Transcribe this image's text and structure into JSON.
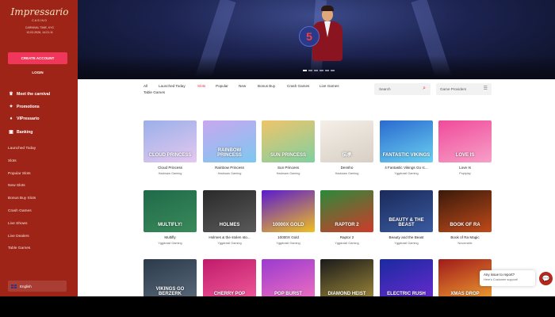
{
  "brand": {
    "name": "Impressario",
    "sub": "CASINO"
  },
  "meta": {
    "line1": "CARNIVAL TIME, KYC",
    "line2": "13.03.2026, 14:21:11"
  },
  "auth": {
    "create_account": "CREATE ACCOUNT",
    "login": "LOGIN"
  },
  "menu": [
    {
      "label": "Meet the carnival",
      "icon": "mask-icon",
      "glyph": "♛"
    },
    {
      "label": "Promotions",
      "icon": "gift-icon",
      "glyph": "✦"
    },
    {
      "label": "VIPressario",
      "icon": "vip-icon",
      "glyph": "♦"
    },
    {
      "label": "Banking",
      "icon": "wallet-icon",
      "glyph": "▣"
    }
  ],
  "categories": [
    "Launched Today",
    "Slots",
    "Popular Slots",
    "New Slots",
    "Bonus Buy Slots",
    "Crash Games",
    "Live Shows",
    "Live Dealers",
    "Table Games"
  ],
  "language": "English",
  "filters": {
    "tabs": [
      "All",
      "Launched Today",
      "Slots",
      "Popular",
      "New",
      "Bonus Buy",
      "Crash Games",
      "Live Games",
      "Table Games"
    ],
    "active": "Slots",
    "search_placeholder": "Search",
    "providers_label": "Game Providers"
  },
  "hero": {
    "badge": "5"
  },
  "games": [
    {
      "name": "Cloud Princess",
      "provider": "Hacksaw Gaming",
      "thumb_text": "CLOUD PRINCESS",
      "bg": "#9ab0e8",
      "bg2": "#e5c8f0"
    },
    {
      "name": "Rainbow Princess",
      "provider": "Hacksaw Gaming",
      "thumb_text": "RAINBOW PRINCESS",
      "bg": "#c9a7ef",
      "bg2": "#7cc8f0"
    },
    {
      "name": "Sun Princess",
      "provider": "Hacksaw Gaming",
      "thumb_text": "SUN PRINCESS",
      "bg": "#f0c46a",
      "bg2": "#7fd0a0"
    },
    {
      "name": "Densho",
      "provider": "Hacksaw Gaming",
      "thumb_text": "伝承",
      "bg": "#f4efe8",
      "bg2": "#d8cfc4"
    },
    {
      "name": "4 Fantastic Vikings Go Ic...",
      "provider": "Yggdrasil Gaming",
      "thumb_text": "FANTASTIC VIKINGS",
      "bg": "#2a6ad0",
      "bg2": "#6ad0f0"
    },
    {
      "name": "Love Is",
      "provider": "Popiplay",
      "thumb_text": "LOVE IS",
      "bg": "#f04a9a",
      "bg2": "#f7a0c8"
    },
    {
      "name": "Multifly",
      "provider": "Yggdrasil Gaming",
      "thumb_text": "MULTIFLY!",
      "bg": "#1f6a4a",
      "bg2": "#3a8a5a"
    },
    {
      "name": "Holmes & the stolen sto...",
      "provider": "Yggdrasil Gaming",
      "thumb_text": "HOLMES",
      "bg": "#2a2a2a",
      "bg2": "#5a5a5a"
    },
    {
      "name": "10000X Gold",
      "provider": "Yggdrasil Gaming",
      "thumb_text": "10000X GOLD",
      "bg": "#5a1ad0",
      "bg2": "#f0c020"
    },
    {
      "name": "Raptor 2",
      "provider": "Yggdrasil Gaming",
      "thumb_text": "RAPTOR 2",
      "bg": "#2a8a3a",
      "bg2": "#d03a2a"
    },
    {
      "name": "Beauty and the Beast",
      "provider": "Yggdrasil Gaming",
      "thumb_text": "BEAUTY & THE BEAST",
      "bg": "#1a2a5a",
      "bg2": "#3a5aa0"
    },
    {
      "name": "Book of Ra Magic",
      "provider": "Novomatic",
      "thumb_text": "BOOK OF RA",
      "bg": "#3a1a0a",
      "bg2": "#c04a1a"
    },
    {
      "name": "",
      "provider": "",
      "thumb_text": "VIKINGS GO BERZERK",
      "bg": "#2a3a4a",
      "bg2": "#5a6a7a"
    },
    {
      "name": "",
      "provider": "",
      "thumb_text": "CHERRY POP",
      "bg": "#c01a6a",
      "bg2": "#f05a9a"
    },
    {
      "name": "",
      "provider": "",
      "thumb_text": "POP BURST",
      "bg": "#9a3ad0",
      "bg2": "#f070c0"
    },
    {
      "name": "",
      "provider": "",
      "thumb_text": "DIAMOND HEIST",
      "bg": "#1a1a1a",
      "bg2": "#a08a3a"
    },
    {
      "name": "",
      "provider": "",
      "thumb_text": "ELECTRIC RUSH",
      "bg": "#1a2aa0",
      "bg2": "#6a2ad0"
    },
    {
      "name": "",
      "provider": "",
      "thumb_text": "XMAS DROP",
      "bg": "#a01a1a",
      "bg2": "#f0a030"
    }
  ],
  "chat": {
    "line1": "Any issue to report?",
    "line2": "Here's Customer support!"
  },
  "colors": {
    "sidebar": "#9e2418",
    "accent": "#e8334a",
    "create": "#f0365a"
  }
}
